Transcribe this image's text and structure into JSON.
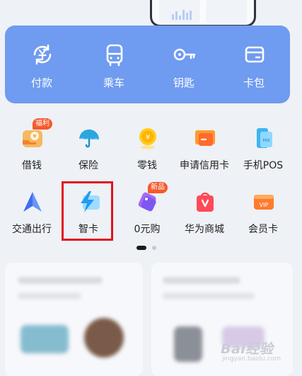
{
  "quick_actions": [
    {
      "label": "付款",
      "icon": "payment-refresh-icon"
    },
    {
      "label": "乘车",
      "icon": "bus-icon"
    },
    {
      "label": "钥匙",
      "icon": "key-icon"
    },
    {
      "label": "卡包",
      "icon": "card-wallet-icon"
    }
  ],
  "services": [
    {
      "label": "借钱",
      "icon": "borrow-money-icon",
      "badge": "福利"
    },
    {
      "label": "保险",
      "icon": "umbrella-icon"
    },
    {
      "label": "零钱",
      "icon": "coin-icon"
    },
    {
      "label": "申请信用卡",
      "icon": "credit-card-apply-icon"
    },
    {
      "label": "手机POS",
      "icon": "mobile-pos-icon"
    },
    {
      "label": "交通出行",
      "icon": "navigation-arrow-icon"
    },
    {
      "label": "智卡",
      "icon": "smart-card-lightning-icon"
    },
    {
      "label": "0元购",
      "icon": "tag-icon",
      "badge": "新品"
    },
    {
      "label": "华为商城",
      "icon": "shopping-bag-icon"
    },
    {
      "label": "会员卡",
      "icon": "vip-card-icon"
    }
  ],
  "pager": {
    "active_index": 0,
    "count": 2
  },
  "watermark": {
    "brand": "Bai经验",
    "url": "jingyan.baidu.com"
  },
  "colors": {
    "quickbar": "#6f9bf0",
    "highlight": "#e0141e",
    "badge": "#f55a2c"
  }
}
